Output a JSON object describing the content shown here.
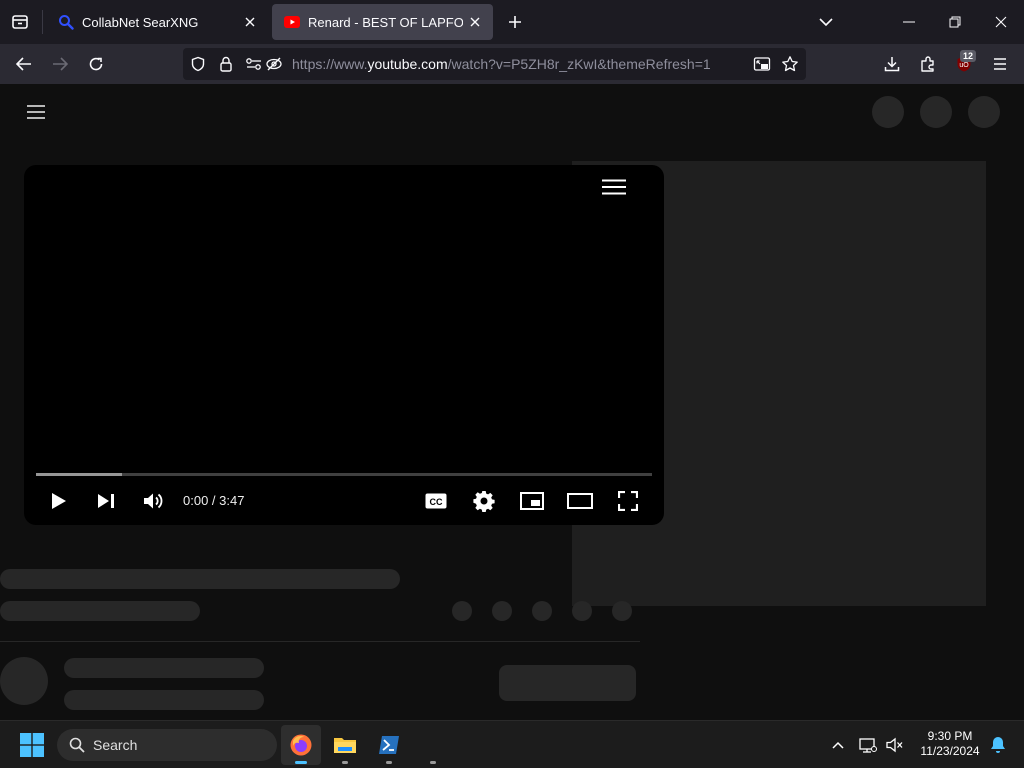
{
  "browser": {
    "tabs": [
      {
        "title": "CollabNet SearXNG",
        "active": false,
        "favicon": "search-icon"
      },
      {
        "title": "Renard - BEST OF LAPFOX VOL",
        "active": true,
        "favicon": "youtube-icon"
      }
    ],
    "url": {
      "prefix": "https://www.",
      "host": "youtube.com",
      "path": "/watch?v=P5ZH8r_zKwI&themeRefresh=1"
    },
    "extension_badge": "12"
  },
  "player": {
    "time": "0:00 / 3:47",
    "buffered_fraction": 0.14
  },
  "taskbar": {
    "search_label": "Search",
    "time": "9:30 PM",
    "date": "11/23/2024"
  },
  "colors": {
    "accent_blue": "#0a84ff",
    "youtube_red": "#ff0000",
    "skeleton": "#272727"
  }
}
